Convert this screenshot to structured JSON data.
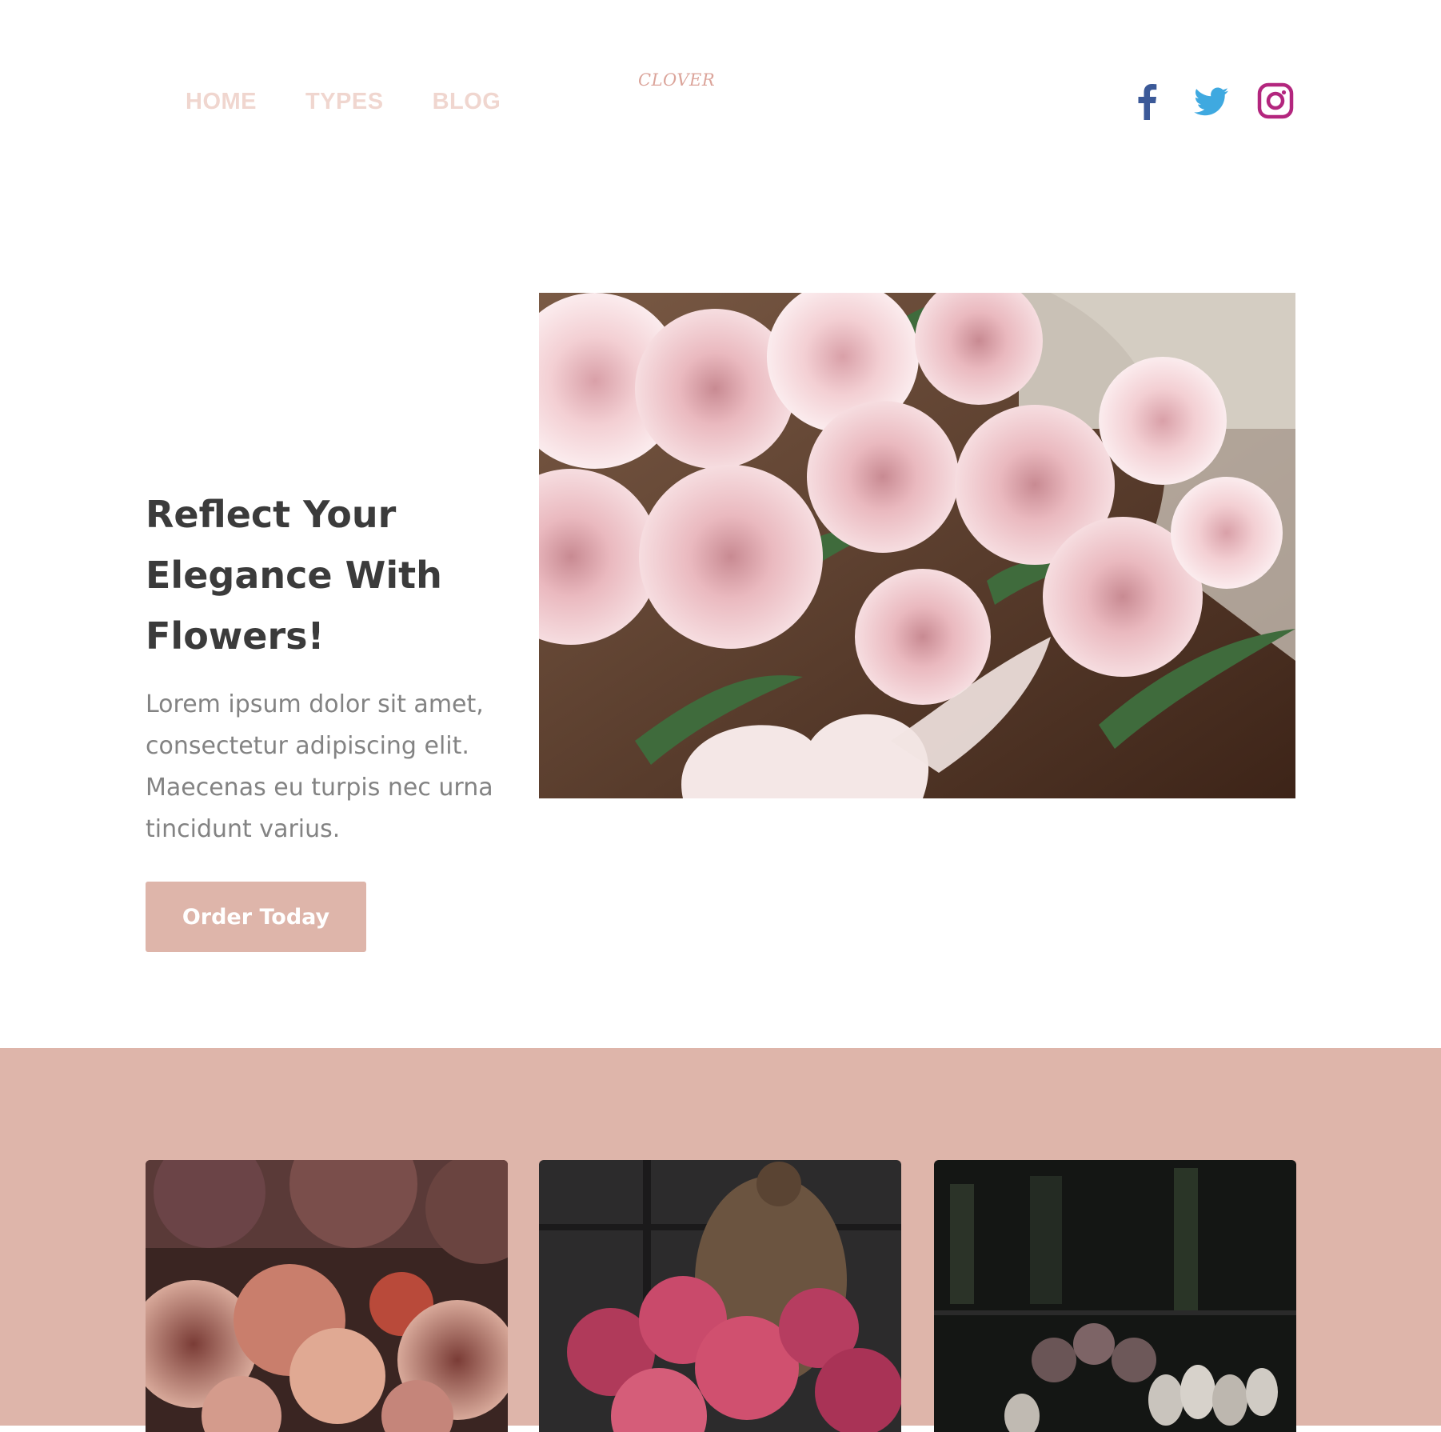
{
  "nav": {
    "items": [
      {
        "label": "HOME"
      },
      {
        "label": "TYPES"
      },
      {
        "label": "BLOG"
      }
    ]
  },
  "logo": {
    "text": "CLOVER"
  },
  "social": [
    {
      "icon": "facebook-icon",
      "color": "#3b5998"
    },
    {
      "icon": "twitter-icon",
      "color": "#1da1f2"
    },
    {
      "icon": "instagram-icon",
      "color": "#b3267e"
    }
  ],
  "hero": {
    "title": "Reflect Your Elegance With Flowers!",
    "text": "Lorem ipsum dolor sit amet, consectetur adipiscing elit. Maecenas eu turpis nec urna tincidunt varius.",
    "cta_label": "Order Today"
  },
  "colors": {
    "accent": "#deb5aa",
    "nav_text": "#f0d6cf",
    "heading": "#3b3b3b",
    "body_text": "#838383"
  }
}
